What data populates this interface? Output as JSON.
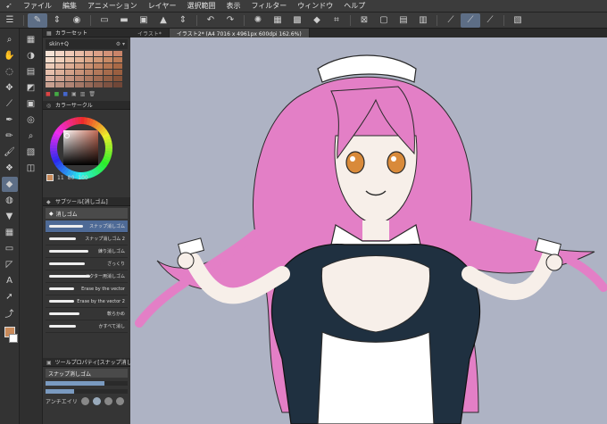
{
  "menu": {
    "items": [
      "ファイル",
      "編集",
      "アニメーション",
      "レイヤー",
      "選択範囲",
      "表示",
      "フィルター",
      "ウィンドウ",
      "ヘルプ"
    ]
  },
  "tabs": [
    {
      "label": "イラスト*"
    },
    {
      "label": "イラスト2* (A4 7016 x 4961px 600dpi 162.6%)"
    }
  ],
  "color_set": {
    "title": "カラーセット",
    "selected": "skin+Q",
    "swatches": [
      "#f6e3d6",
      "#f3d5c5",
      "#efc9b6",
      "#e9bca6",
      "#e3ae96",
      "#dca087",
      "#d39278",
      "#c98469",
      "#f4dccb",
      "#efcfba",
      "#e9c1a8",
      "#e2b397",
      "#daa586",
      "#d19775",
      "#c78965",
      "#bc7b56",
      "#eccbb8",
      "#e5bca6",
      "#ddad94",
      "#d49f83",
      "#ca9172",
      "#c08362",
      "#b57653",
      "#a96946",
      "#e5bfac",
      "#dcb09a",
      "#d2a189",
      "#c89379",
      "#bd8569",
      "#b2785a",
      "#a66b4c",
      "#9a5f40",
      "#d9b0a0",
      "#cea18f",
      "#c3937f",
      "#b8856f",
      "#ac7860",
      "#a06b52",
      "#935f45",
      "#86533a",
      "#c8a090",
      "#bc9282",
      "#b08474",
      "#a47766",
      "#976a59",
      "#8a5e4d",
      "#7d5242",
      "#704738"
    ]
  },
  "color_circle": {
    "title": "カラーサークル",
    "values": [
      "11",
      "80",
      "100"
    ]
  },
  "subtool": {
    "title": "サブツール[消しゴム]",
    "group_label": "消しゴム",
    "brushes": [
      {
        "label": "スナップ消しゴム"
      },
      {
        "label": "スナップ消しゴム 2"
      },
      {
        "label": "練り消しゴム"
      },
      {
        "label": "ざっくり"
      },
      {
        "label": "ベクター用消しゴム"
      },
      {
        "label": "Erase by the vector"
      },
      {
        "label": "Erase by the vector 2"
      },
      {
        "label": "軟らかめ"
      },
      {
        "label": "かすべて消し"
      }
    ]
  },
  "tool_property": {
    "title": "ツールプロパティ[スナップ消しゴム]",
    "name": "スナップ消しゴム",
    "footer_label": "アンチエイリ",
    "size_level": 0.72,
    "opacity_level": 0.35
  },
  "colors": {
    "accent": "#5d6e86",
    "foreground": "#c98a5a",
    "canvas_bg": "#aeb3c4",
    "hair": "#e37fc6",
    "outfit": "#1f3040"
  }
}
